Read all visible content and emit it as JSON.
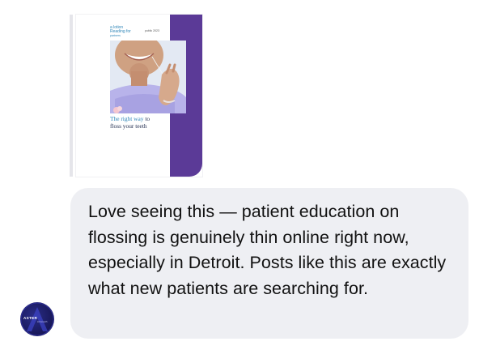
{
  "shared_post": {
    "logo_line1": "a lotion",
    "logo_line2": "Reading for",
    "logo_line3": "partners",
    "date_text": "public 2023",
    "title_part1": "The right way",
    "title_part2": " to",
    "title_line2": "floss your teeth",
    "colors": {
      "brand_purple": "#5b3a97",
      "accent_blue": "#2f86b8",
      "title_navy": "#1f2b4d"
    }
  },
  "reply": {
    "text": "Love seeing this — patient education on flossing is genuinely thin online right now, especially in Detroit. Posts like this are exactly what new patients are searching for.",
    "bubble_color": "#eeeff3"
  },
  "avatar": {
    "brand": "ASTER",
    "sub": "AI Growth",
    "background": "#1a1a5e"
  }
}
